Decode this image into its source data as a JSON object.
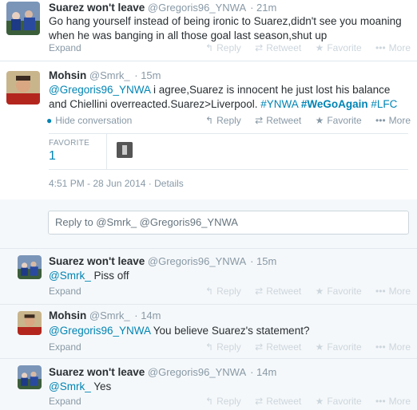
{
  "tweet1": {
    "name": "Suarez won't leave",
    "handle": "@Gregoris96_YNWA",
    "time": "· 21m",
    "text": "Go hang yourself instead of being ironic to Suarez,didn't see you moaning when he was banging in all those goal last season,shut up",
    "expand": "Expand"
  },
  "main": {
    "name": "Mohsin",
    "handle": "@Smrk_",
    "time": "· 15m",
    "mention": "@Gregoris96_YNWA",
    "text": " i agree,Suarez is innocent he just lost his balance and Chiellini overreacted.Suarez>Liverpool. ",
    "hashtag1": "#YNWA",
    "hashtag2": "#WeGoAgain",
    "hashtag3": "#LFC",
    "hide": "Hide conversation",
    "favorite_label": "FAVORITE",
    "favorite_count": "1",
    "date": "4:51 PM - 28 Jun 2014",
    "details": "Details"
  },
  "actions": {
    "reply": "Reply",
    "retweet": "Retweet",
    "favorite": "Favorite",
    "more": "More"
  },
  "reply_box": {
    "placeholder": "Reply to @Smrk_ @Gregoris96_YNWA"
  },
  "replies": [
    {
      "name": "Suarez won't leave",
      "handle": "@Gregoris96_YNWA",
      "time": "· 15m",
      "mention": "@Smrk_",
      "text": " Piss off",
      "expand": "Expand"
    },
    {
      "name": "Mohsin",
      "handle": "@Smrk_",
      "time": "· 14m",
      "mention": "@Gregoris96_YNWA",
      "text": " You believe Suarez's statement?",
      "expand": "Expand"
    },
    {
      "name": "Suarez won't leave",
      "handle": "@Gregoris96_YNWA",
      "time": "· 14m",
      "mention": "@Smrk_",
      "text": " Yes",
      "expand": "Expand"
    }
  ],
  "colors": {
    "link": "#0084b4",
    "muted": "#8899a6",
    "text": "#292f33",
    "border": "#e1e8ed",
    "bg": "#f5f8fa"
  },
  "icons": [
    "reply-icon",
    "retweet-icon",
    "favorite-star-icon",
    "more-dots-icon",
    "speech-bubble-icon"
  ]
}
